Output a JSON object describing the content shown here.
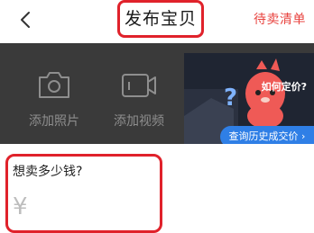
{
  "nav": {
    "title": "发布宝贝",
    "right_link": "待卖清单"
  },
  "media": {
    "photo_label": "添加照片",
    "video_label": "添加视频",
    "promo": {
      "question": "如何定价?",
      "button_label": "查询历史成交价",
      "button_chevron": "›"
    }
  },
  "price": {
    "prompt": "想卖多少钱?",
    "currency_symbol": "¥"
  },
  "colors": {
    "accent_red": "#e0222b",
    "link_red": "#e8433f",
    "promo_blue": "#2f7fe6",
    "media_bg": "#3a3a3a"
  }
}
